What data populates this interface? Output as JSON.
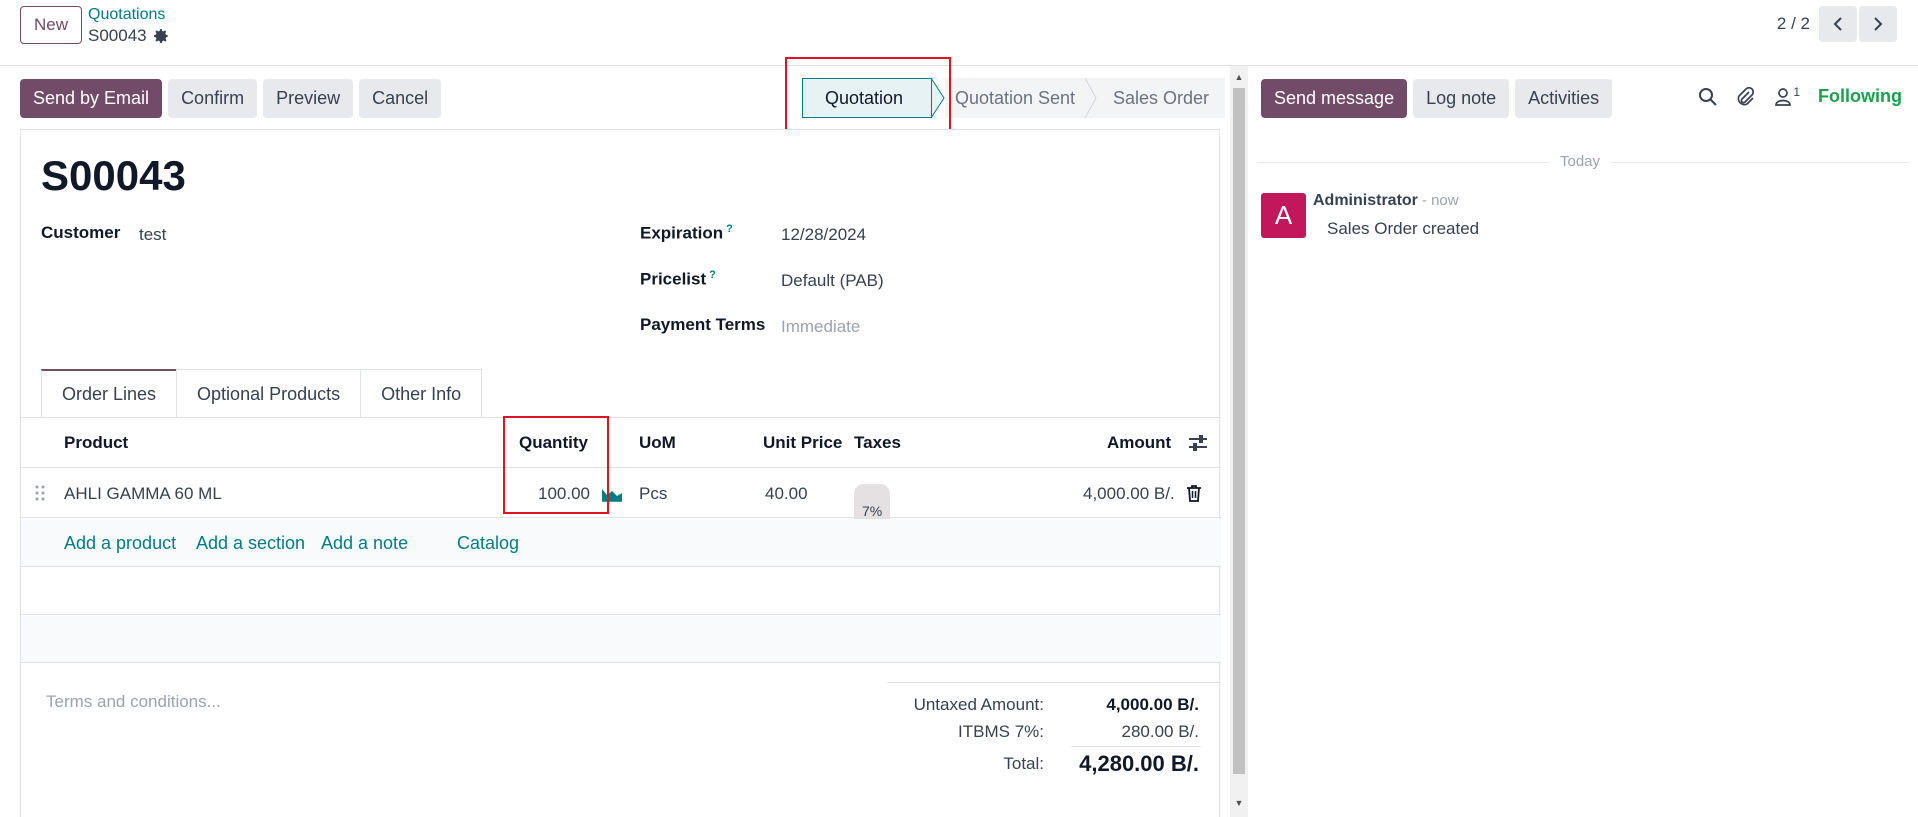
{
  "topbar": {
    "new_label": "New",
    "breadcrumb_parent": "Quotations",
    "breadcrumb_current": "S00043",
    "pager": "2 / 2"
  },
  "actions": {
    "send_email": "Send by Email",
    "confirm": "Confirm",
    "preview": "Preview",
    "cancel": "Cancel"
  },
  "status": {
    "stages": [
      "Quotation",
      "Quotation Sent",
      "Sales Order"
    ],
    "active": "Quotation"
  },
  "form": {
    "title": "S00043",
    "customer_label": "Customer",
    "customer_value": "test",
    "expiration_label": "Expiration",
    "expiration_help": "?",
    "expiration_value": "12/28/2024",
    "pricelist_label": "Pricelist",
    "pricelist_help": "?",
    "pricelist_value": "Default (PAB)",
    "payment_terms_label": "Payment Terms",
    "payment_terms_value": "Immediate"
  },
  "tabs": [
    "Order Lines",
    "Optional Products",
    "Other Info"
  ],
  "table": {
    "headers": {
      "product": "Product",
      "quantity": "Quantity",
      "uom": "UoM",
      "unit_price": "Unit Price",
      "taxes": "Taxes",
      "amount": "Amount"
    },
    "rows": [
      {
        "product": "AHLI GAMMA 60 ML",
        "quantity": "100.00",
        "uom": "Pcs",
        "unit_price": "40.00",
        "taxes": "7%",
        "amount": "4,000.00 B/."
      }
    ],
    "add_product": "Add a product",
    "add_section": "Add a section",
    "add_note": "Add a note",
    "catalog": "Catalog"
  },
  "footer": {
    "terms_placeholder": "Terms and conditions...",
    "untaxed_label": "Untaxed Amount:",
    "untaxed_value": "4,000.00 B/.",
    "tax_label": "ITBMS 7%:",
    "tax_value": "280.00 B/.",
    "total_label": "Total:",
    "total_value": "4,280.00 B/."
  },
  "chatter": {
    "send_message": "Send message",
    "log_note": "Log note",
    "activities": "Activities",
    "follower_count": "1",
    "following": "Following",
    "date_separator": "Today",
    "messages": [
      {
        "avatar_letter": "A",
        "author": "Administrator",
        "time": "- now",
        "body": "Sales Order created"
      }
    ]
  },
  "colors": {
    "brand": "#714b67",
    "link": "#017e84",
    "highlight": "#e0141e",
    "following": "#16a34a",
    "avatar": "#c2185b"
  }
}
